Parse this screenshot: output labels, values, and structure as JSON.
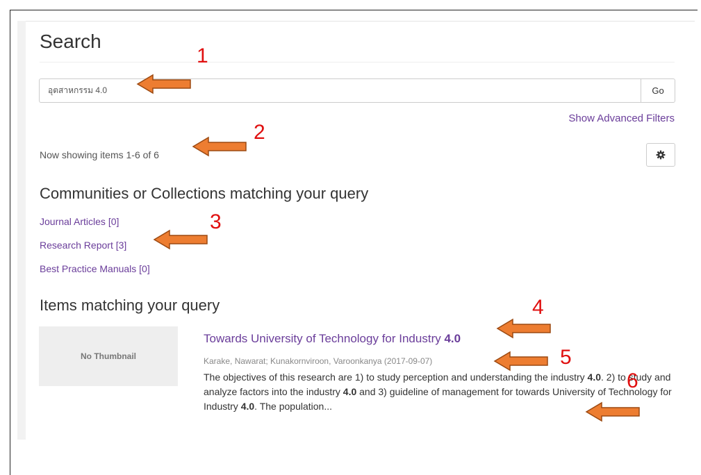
{
  "page": {
    "title": "Search"
  },
  "search": {
    "query": "อุตสาหกรรม 4.0",
    "go_label": "Go",
    "advanced_filters_label": "Show Advanced Filters"
  },
  "results": {
    "showing_text": "Now showing items 1-6 of 6"
  },
  "communities": {
    "heading": "Communities or Collections matching your query",
    "items": [
      {
        "label": "Journal Articles [0]"
      },
      {
        "label": "Research Report [3]"
      },
      {
        "label": "Best Practice Manuals [0]"
      }
    ]
  },
  "items_section": {
    "heading": "Items matching your query",
    "items": [
      {
        "thumbnail_text": "No Thumbnail",
        "title_text": "Towards University of Technology for Industry ",
        "title_bold": "4.0",
        "meta": "Karake, Nawarat; Kunakornviroon, Varoonkanya (2017-09-07)",
        "abstract_parts": [
          {
            "text": "The objectives of this research are 1) to study perception and understanding the industry "
          },
          {
            "bold": "4.0"
          },
          {
            "text": ". 2) to study and analyze factors into the industry "
          },
          {
            "bold": "4.0"
          },
          {
            "text": " and 3) guideline of management for towards University of Technology for Industry "
          },
          {
            "bold": "4.0"
          },
          {
            "text": ". The population..."
          }
        ]
      }
    ]
  },
  "annotations": {
    "markers": [
      "1",
      "2",
      "3",
      "4",
      "5",
      "6"
    ],
    "arrow_color": "#ed7d31",
    "arrow_border_color": "#9c4a12",
    "marker_color": "#e01010"
  },
  "icons": {
    "settings": "gear-icon"
  },
  "colors": {
    "link": "#6a3d9a",
    "muted_text": "#888888"
  }
}
